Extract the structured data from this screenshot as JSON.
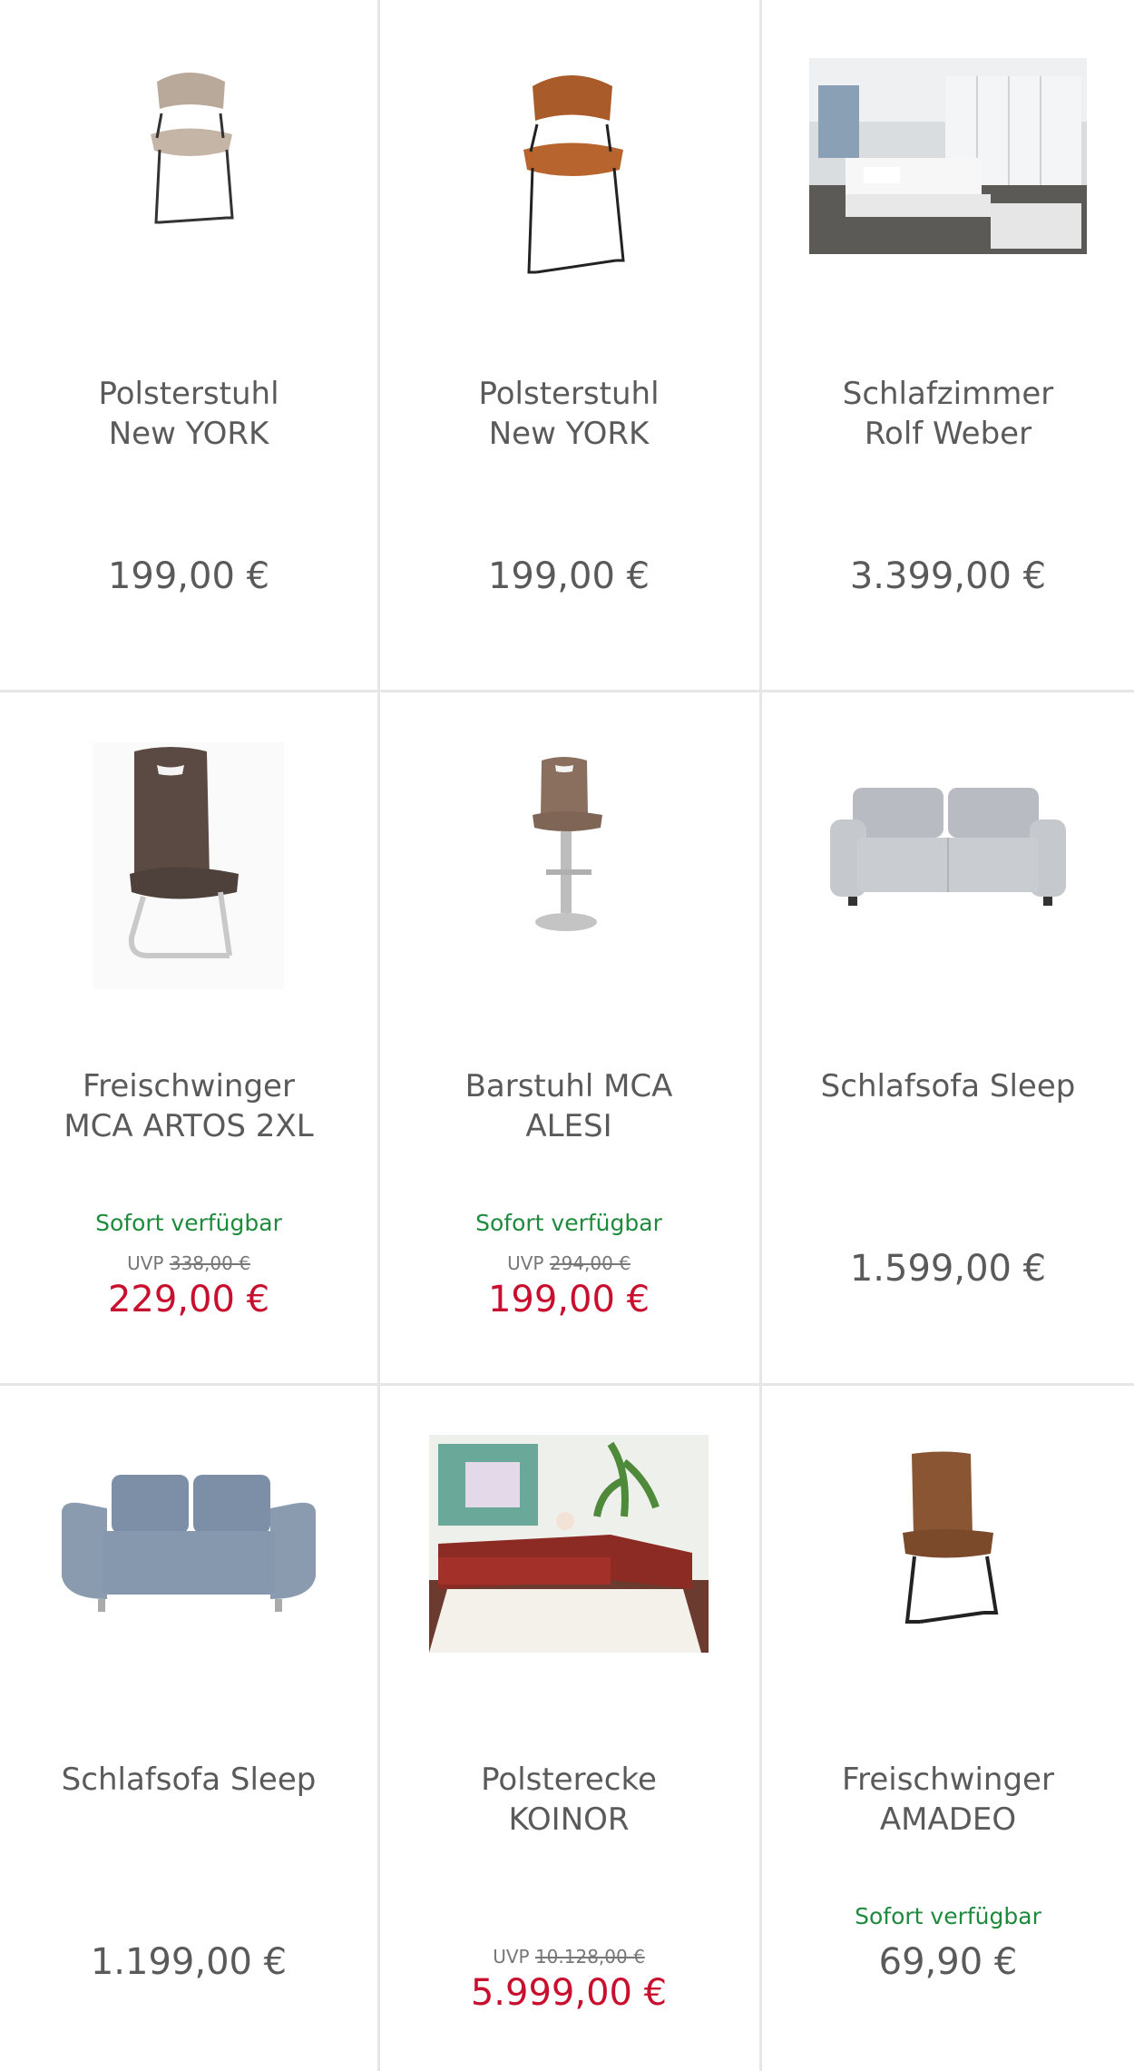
{
  "products": [
    {
      "name": "Polsterstuhl New YORK",
      "name_line1": "Polsterstuhl",
      "name_line2": "New YORK",
      "price": "199,00 €",
      "icon": "chair-taupe-icon"
    },
    {
      "name": "Polsterstuhl New YORK",
      "name_line1": "Polsterstuhl",
      "name_line2": "New YORK",
      "price": "199,00 €",
      "icon": "chair-cognac-icon"
    },
    {
      "name": "Schlafzimmer Rolf Weber",
      "name_line1": "Schlafzimmer",
      "name_line2": "Rolf Weber",
      "price": "3.399,00 €",
      "icon": "bedroom-photo"
    },
    {
      "name": "Freischwinger MCA ARTOS 2XL",
      "name_line1": "Freischwinger",
      "name_line2": "MCA ARTOS 2XL",
      "availability": "Sofort verfügbar",
      "uvp_label": "UVP",
      "uvp_price": "338,00 €",
      "price": "229,00 €",
      "icon": "cantilever-chair-icon"
    },
    {
      "name": "Barstuhl MCA ALESI",
      "name_line1": "Barstuhl MCA",
      "name_line2": "ALESI",
      "availability": "Sofort verfügbar",
      "uvp_label": "UVP",
      "uvp_price": "294,00 €",
      "price": "199,00 €",
      "icon": "bar-stool-icon"
    },
    {
      "name": "Schlafsofa Sleep",
      "name_line1": "Schlafsofa Sleep",
      "name_line2": "",
      "price": "1.599,00 €",
      "icon": "sofa-grey-icon"
    },
    {
      "name": "Schlafsofa Sleep",
      "name_line1": "Schlafsofa Sleep",
      "name_line2": "",
      "price": "1.199,00 €",
      "icon": "sofa-blue-icon"
    },
    {
      "name": "Polsterecke KOINOR",
      "name_line1": "Polsterecke",
      "name_line2": "KOINOR",
      "uvp_label": "UVP",
      "uvp_price": "10.128,00 €",
      "price": "5.999,00 €",
      "icon": "corner-sofa-photo"
    },
    {
      "name": "Freischwinger AMADEO",
      "name_line1": "Freischwinger",
      "name_line2": "AMADEO",
      "availability": "Sofort verfügbar",
      "price": "69,90 €",
      "icon": "cantilever-chair-brown-icon"
    }
  ],
  "colors": {
    "sale_price": "#c8102e",
    "availability": "#1e8a3c",
    "text": "#5a5a5a",
    "divider": "#e6e6e6"
  }
}
